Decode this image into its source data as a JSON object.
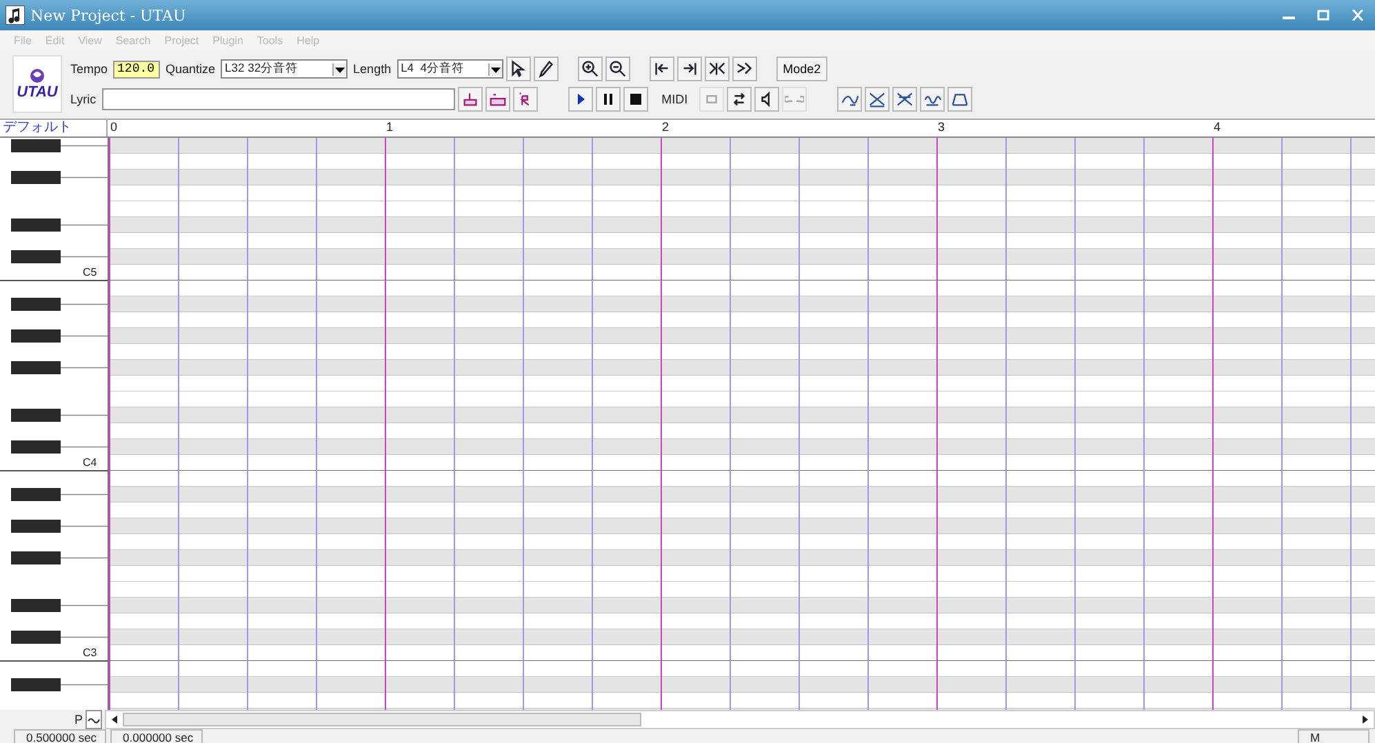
{
  "window": {
    "title": "New Project - UTAU"
  },
  "menu": [
    "File",
    "Edit",
    "View",
    "Search",
    "Project",
    "Plugin",
    "Tools",
    "Help"
  ],
  "toolbar": {
    "logo": "UTAU",
    "tempo_label": "Tempo",
    "tempo": "120.0",
    "quantize_label": "Quantize",
    "quantize": "L32 32分音符",
    "length_label": "Length",
    "length": "L4  4分音符",
    "mode_button": "Mode2",
    "lyric_label": "Lyric",
    "midi_label": "MIDI"
  },
  "track": {
    "name": "デフォルト"
  },
  "ruler": [
    "0",
    "1",
    "2",
    "3",
    "4"
  ],
  "piano": {
    "octave_labels": [
      "C5",
      "C4",
      "C3"
    ]
  },
  "bottom": {
    "p_label": "P"
  },
  "status_bar": [
    "0.500000 sec",
    "0.000000 sec",
    "M"
  ]
}
